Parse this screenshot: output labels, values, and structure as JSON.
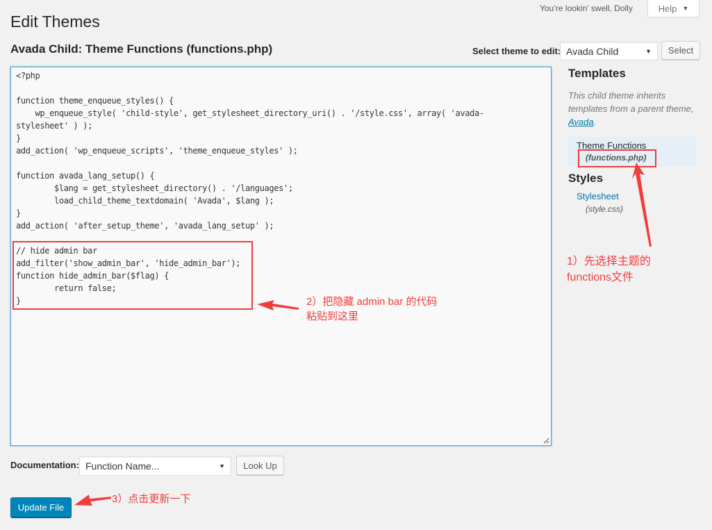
{
  "header": {
    "dolly_text": "You’re lookin’ swell, Dolly",
    "help_label": "Help",
    "page_title": "Edit Themes",
    "file_title": "Avada Child: Theme Functions (functions.php)"
  },
  "theme_selector": {
    "label": "Select theme to edit:",
    "selected": "Avada Child",
    "button_label": "Select"
  },
  "editor": {
    "lines": [
      "<?php",
      "",
      "function theme_enqueue_styles() {",
      "    wp_enqueue_style( 'child-style', get_stylesheet_directory_uri() . '/style.css', array( 'avada-",
      "stylesheet' ) );",
      "}",
      "add_action( 'wp_enqueue_scripts', 'theme_enqueue_styles' );",
      "",
      "function avada_lang_setup() {",
      "        $lang = get_stylesheet_directory() . '/languages';",
      "        load_child_theme_textdomain( 'Avada', $lang );",
      "}",
      "add_action( 'after_setup_theme', 'avada_lang_setup' );",
      "",
      "// hide admin bar",
      "add_filter('show_admin_bar', 'hide_admin_bar');",
      "function hide_admin_bar($flag) {",
      "        return false;",
      "}"
    ]
  },
  "sidebar": {
    "templates_heading": "Templates",
    "inherit_note_prefix": "This child theme inherits templates from a parent theme, ",
    "inherit_note_link": "Avada",
    "inherit_note_suffix": ".",
    "templates": [
      {
        "name": "Theme Functions",
        "file": "(functions.php)",
        "active": true
      }
    ],
    "styles_heading": "Styles",
    "styles": [
      {
        "name": "Stylesheet",
        "file": "(style.css)"
      }
    ]
  },
  "documentation": {
    "label": "Documentation:",
    "selected": "Function Name...",
    "button_label": "Look Up"
  },
  "update_button_label": "Update File",
  "annotations": {
    "step1_line1": "1）先选择主题的",
    "step1_line2": "functions文件",
    "step2_line1": "2）把隐藏 admin bar 的代码",
    "step2_line2": "粘贴到这里",
    "step3": "3）点击更新一下",
    "color": "#f23c3c"
  }
}
